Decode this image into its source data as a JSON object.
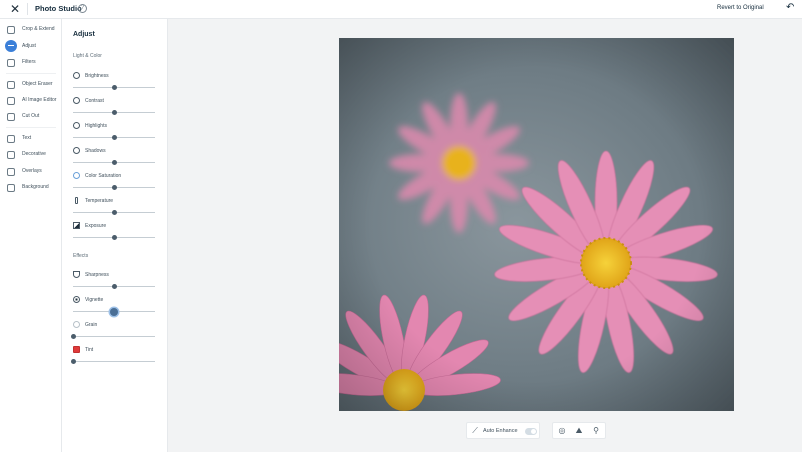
{
  "header": {
    "app_title": "Photo Studio",
    "help_glyph": "?",
    "revert_label": "Revert to Original"
  },
  "nav": {
    "items": [
      {
        "label": "Crop & Extend",
        "icon": "crop-icon"
      },
      {
        "label": "Adjust",
        "icon": "adjust-icon",
        "active": true
      },
      {
        "label": "Filters",
        "icon": "filters-icon"
      },
      {
        "label": "Object Eraser",
        "icon": "eraser-icon"
      },
      {
        "label": "AI Image Editor",
        "icon": "ai-edit-icon"
      },
      {
        "label": "Cut Out",
        "icon": "cutout-icon"
      },
      {
        "label": "Text",
        "icon": "text-icon"
      },
      {
        "label": "Decorative",
        "icon": "decorative-icon"
      },
      {
        "label": "Overlays",
        "icon": "overlays-icon"
      },
      {
        "label": "Background",
        "icon": "background-icon"
      }
    ]
  },
  "panel": {
    "title": "Adjust",
    "light_color_label": "Light & Color",
    "effects_label": "Effects",
    "light_controls": [
      {
        "label": "Brightness",
        "icon": "brightness-icon",
        "value": 0.5
      },
      {
        "label": "Contrast",
        "icon": "contrast-icon",
        "value": 0.5
      },
      {
        "label": "Highlights",
        "icon": "highlights-icon",
        "value": 0.5
      },
      {
        "label": "Shadows",
        "icon": "shadows-icon",
        "value": 0.5
      },
      {
        "label": "Color Saturation",
        "icon": "saturation-icon",
        "value": 0.5
      },
      {
        "label": "Temperature",
        "icon": "temperature-icon",
        "value": 0.5
      },
      {
        "label": "Exposure",
        "icon": "exposure-icon",
        "value": 0.5
      }
    ],
    "effect_controls": [
      {
        "label": "Sharpness",
        "icon": "sharpness-icon",
        "value": 0.5
      },
      {
        "label": "Vignette",
        "icon": "vignette-icon",
        "value": 0.5,
        "active": true
      },
      {
        "label": "Grain",
        "icon": "grain-icon",
        "value": 0.0
      },
      {
        "label": "Tint",
        "icon": "tint-icon",
        "value": 0.0,
        "color": "#e03a3a"
      }
    ]
  },
  "toolbar": {
    "auto_enhance_label": "Auto Enhance",
    "auto_enhance_on": false
  },
  "colors": {
    "accent": "#3b7fd8",
    "petal": "#e98fb8",
    "center": "#f3c21c",
    "background": "#727f87"
  }
}
